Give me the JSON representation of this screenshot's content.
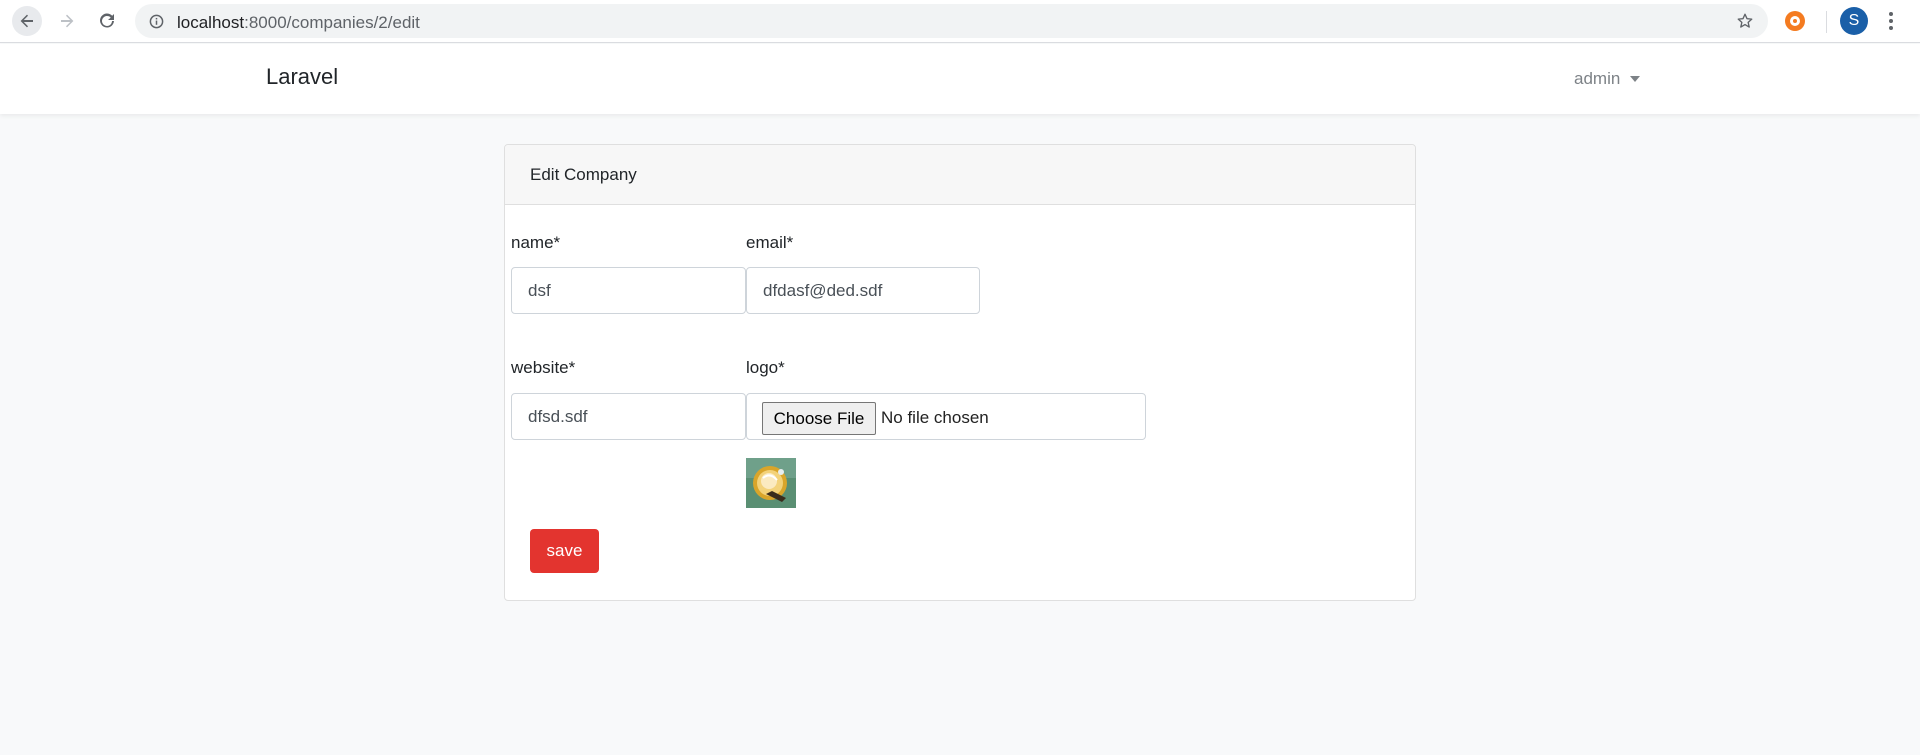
{
  "browser": {
    "url_host": "localhost",
    "url_path": ":8000/companies/2/edit",
    "profile_initial": "S"
  },
  "navbar": {
    "brand": "Laravel",
    "user": "admin"
  },
  "card": {
    "title": "Edit Company"
  },
  "form": {
    "name_label": "name*",
    "name_value": "dsf",
    "email_label": "email*",
    "email_value": "dfdasf@ded.sdf",
    "website_label": "website*",
    "website_value": "dfsd.sdf",
    "logo_label": "logo*",
    "file_button": "Choose File",
    "file_status": "No file chosen",
    "save_label": "save"
  },
  "colors": {
    "save_button": "#e3342f",
    "page_background": "#f8f9fa",
    "profile_avatar": "#1a5fa8",
    "extension_icon": "#f47b20"
  },
  "icons": [
    "back-arrow-icon",
    "forward-arrow-icon",
    "reload-icon",
    "info-icon",
    "bookmark-star-icon",
    "extension-icon",
    "chrome-menu-icon",
    "caret-down-icon"
  ]
}
